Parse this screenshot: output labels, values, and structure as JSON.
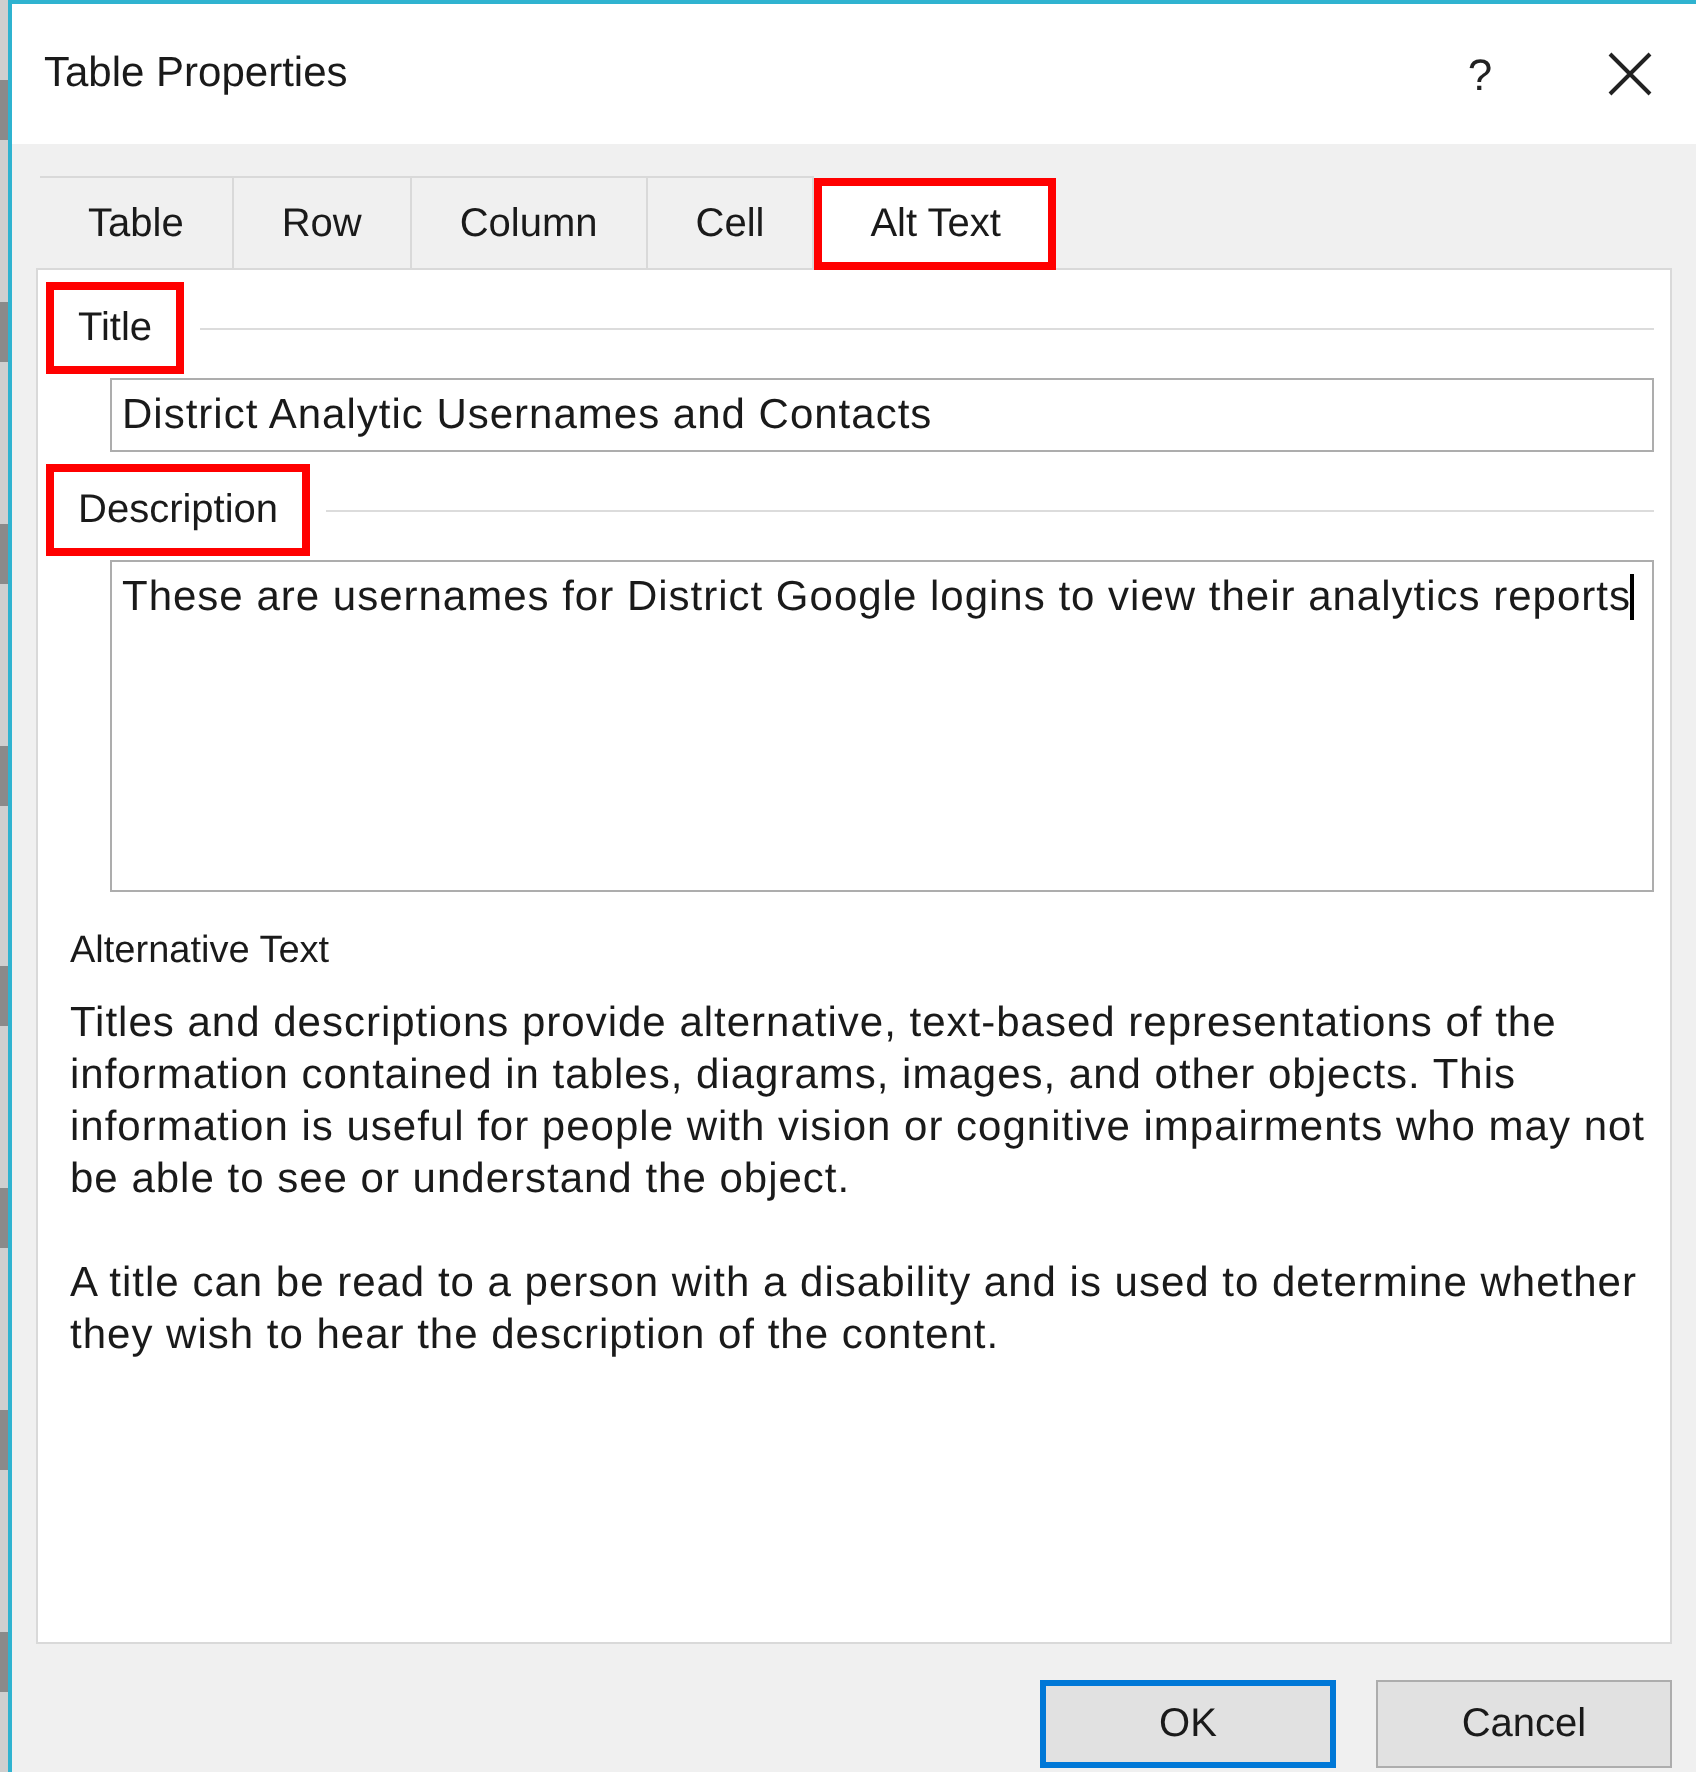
{
  "window": {
    "title": "Table Properties",
    "help": "?"
  },
  "tabs": [
    {
      "label": "Table",
      "selected": false,
      "highlighted": false
    },
    {
      "label": "Row",
      "selected": false,
      "highlighted": false
    },
    {
      "label": "Column",
      "selected": false,
      "highlighted": false
    },
    {
      "label": "Cell",
      "selected": false,
      "highlighted": false
    },
    {
      "label": "Alt Text",
      "selected": true,
      "highlighted": true
    }
  ],
  "title_section": {
    "label": "Title",
    "highlighted": true,
    "value": "District Analytic Usernames and Contacts"
  },
  "description_section": {
    "label": "Description",
    "highlighted": true,
    "value": "These are usernames for District Google logins to view their analytics reports"
  },
  "help_text": {
    "heading": "Alternative Text",
    "paragraphs": [
      "Titles and descriptions provide alternative, text-based representations of the information contained in tables, diagrams, images, and other objects. This information is useful for people with vision or cognitive impairments who may not be able to see or understand the object.",
      "A title can be read to a person with a disability and is used to determine whether they wish to hear the description of the content."
    ]
  },
  "buttons": [
    {
      "label": "OK",
      "default": true
    },
    {
      "label": "Cancel",
      "default": false
    }
  ]
}
